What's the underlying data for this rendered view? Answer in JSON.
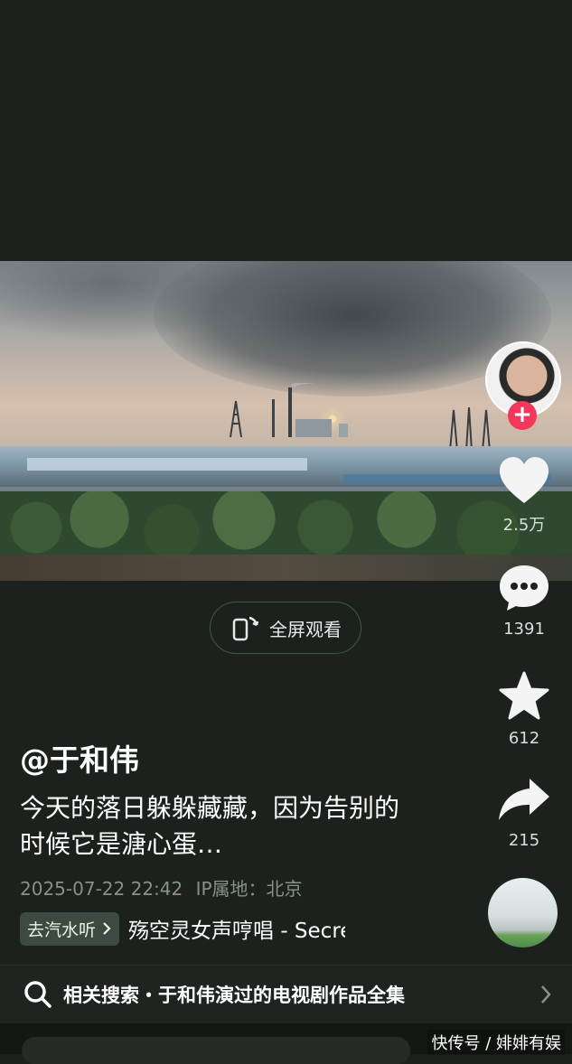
{
  "video": {
    "fullscreen_label": "全屏观看"
  },
  "sidebar": {
    "like_count": "2.5万",
    "comment_count": "1391",
    "favorite_count": "612",
    "share_count": "215"
  },
  "post": {
    "username": "@于和伟",
    "description": "今天的落日躲躲藏藏，因为告别的时候它是溏心蛋…",
    "datetime": "2025-07-22 22:42",
    "ip_location": "IP属地：北京"
  },
  "music": {
    "tag_label": "去汽水听",
    "title": "殇空灵女声哼唱 - Secret"
  },
  "related_search": {
    "text": "相关搜索・于和伟演过的电视剧作品全集"
  },
  "watermark": "快传号 / 婔婔有娱",
  "colors": {
    "background": "#1c211e",
    "follow_badge": "#f2375a",
    "music_tag_bg": "#3c4a41"
  }
}
